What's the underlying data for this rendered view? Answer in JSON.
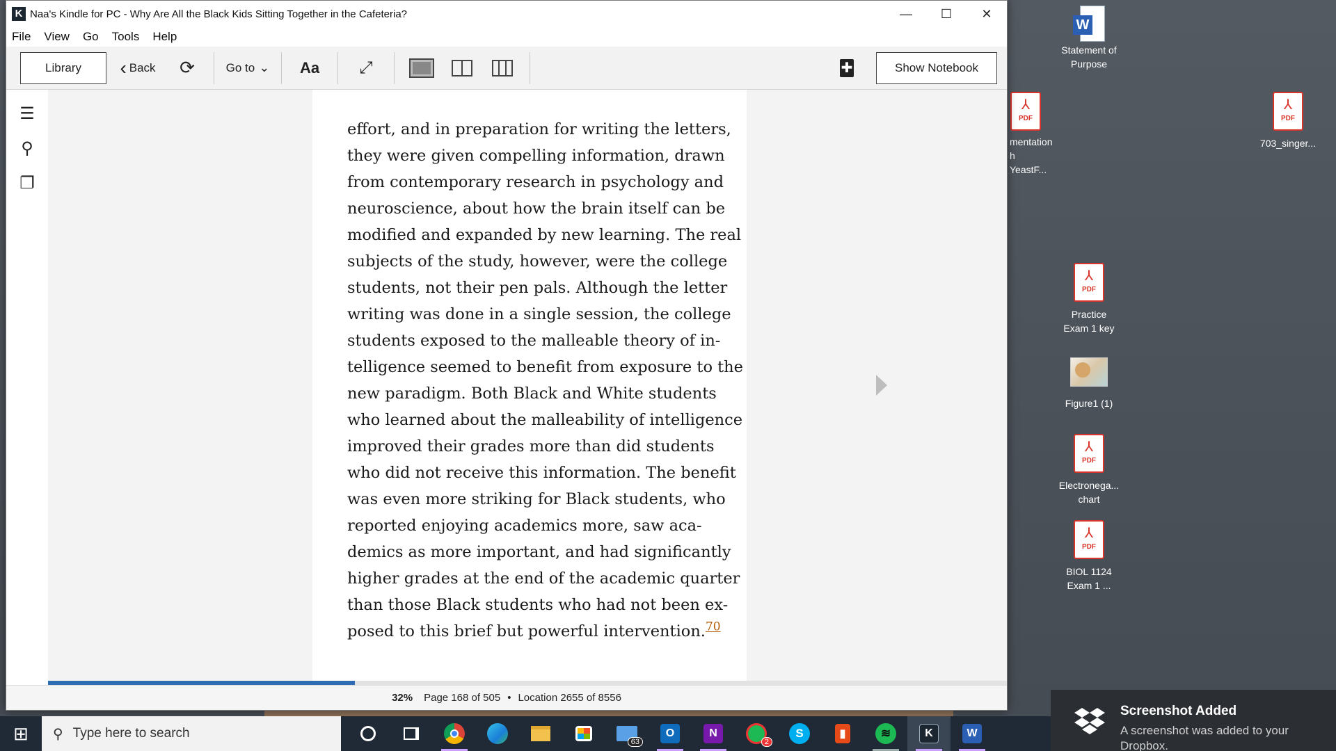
{
  "window": {
    "title": "Naa's Kindle for PC - Why Are All the Black Kids Sitting Together in the Cafeteria?",
    "app_icon": "K",
    "min_glyph": "—",
    "max_glyph": "☐",
    "close_glyph": "✕"
  },
  "menu": [
    "File",
    "View",
    "Go",
    "Tools",
    "Help"
  ],
  "toolbar": {
    "library": "Library",
    "back": "Back",
    "back_glyph": "‹",
    "sync_glyph": "⟳",
    "goto": "Go to",
    "goto_glyph": "⌄",
    "font": "Aa",
    "fullscreen_glyph": "⤢",
    "bookmark_glyph": "✚",
    "show_notebook": "Show Notebook"
  },
  "rail": {
    "toc_glyph": "☰",
    "search_glyph": "⚲",
    "cards_glyph": "❐"
  },
  "book": {
    "lines": [
      "effort, and in preparation for writing the letters,",
      "they were given compelling information, drawn",
      "from contemporary research in psychology and",
      "neuroscience, about how the brain itself can be",
      "modified and expanded by new learning. The real",
      "subjects of the study, however, were the college",
      "students, not their pen pals. Although the letter",
      "writing was done in a single session, the college",
      "students exposed to the malleable theory of in-",
      "telligence seemed to benefit from exposure to the",
      "new paradigm. Both Black and White students",
      "who learned about the malleability of intelligence",
      "improved their grades more than did students",
      "who did not receive this information. The benefit",
      "was even more striking for Black students, who",
      "reported enjoying academics more, saw aca-",
      "demics as more important, and had significantly",
      "higher grades at the end of the academic quarter",
      "than those Black students who had not been ex-"
    ],
    "last_line": "posed to this brief but powerful intervention.",
    "footnote": "70"
  },
  "progress": {
    "percent": 32
  },
  "status": {
    "percent": "32%",
    "page": "Page 168 of 505",
    "dot": "•",
    "location": "Location 2655 of 8556"
  },
  "desktop": {
    "icons": [
      {
        "label1": "Statement of",
        "label2": "Purpose",
        "type": "word"
      },
      {
        "label1": "mentation",
        "label2": "h YeastF...",
        "type": "pdf"
      },
      {
        "label1": "703_singer...",
        "label2": "",
        "type": "pdf"
      },
      {
        "label1": "Practice",
        "label2": "Exam 1 key",
        "type": "pdf"
      },
      {
        "label1": "Figure1 (1)",
        "label2": "",
        "type": "image"
      },
      {
        "label1": "Electronega...",
        "label2": "chart",
        "type": "pdf"
      },
      {
        "label1": "BIOL 1124",
        "label2": "Exam 1 ...",
        "type": "pdf"
      }
    ],
    "pdf_text": "PDF",
    "pdf_glyph": "⅄",
    "word_letter": "W"
  },
  "taskbar": {
    "start_glyph": "⊞",
    "search_placeholder": "Type here to search",
    "search_glyph": "⚲",
    "mail_badge": "63",
    "teams_badge": "2"
  },
  "toast": {
    "title": "Screenshot Added",
    "body": "A screenshot was added to your Dropbox."
  },
  "colors": {
    "progress_fill": "#2e6db4",
    "footnote": "#b35a00",
    "pdf_red": "#d9342b"
  }
}
